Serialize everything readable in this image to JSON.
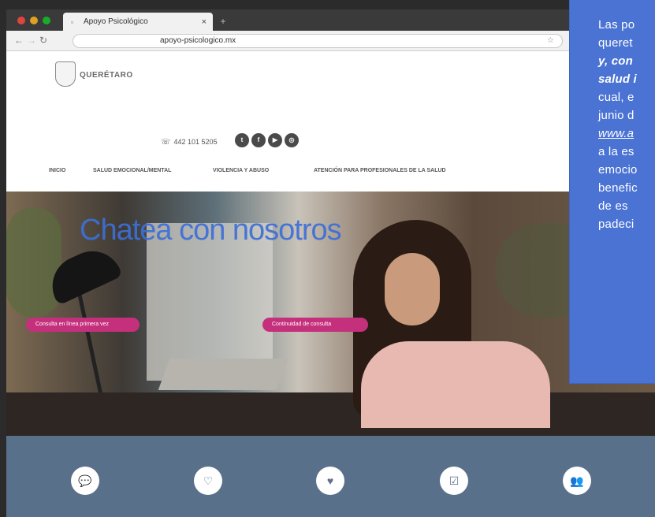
{
  "browser": {
    "tab_title": "Apoyo Psicológico",
    "tab_close": "×",
    "new_tab": "+",
    "url": "apoyo-psicologico.mx"
  },
  "site": {
    "logo_small_text": "",
    "logo_name": "QUERÉTARO",
    "phone": "442 101 5205",
    "nav": [
      {
        "label": "INICIO"
      },
      {
        "label": "SALUD EMOCIONAL/MENTAL"
      },
      {
        "label": "VIOLENCIA Y ABUSO"
      },
      {
        "label": "ATENCIÓN PARA PROFESIONALES DE LA SALUD"
      }
    ],
    "hero_title": "Chatea con nosotros",
    "button_primary": "Consulta en línea primera vez",
    "button_secondary": "Continuidad de consulta"
  },
  "overlay": {
    "lines": [
      "Las po",
      "queret",
      "y, con",
      "salud i",
      "cual, e",
      "junio d",
      "www.a",
      "a la es",
      "emocio",
      "benefic",
      "de es",
      "padeci"
    ]
  },
  "colors": {
    "overlay_bg": "#4a73d4",
    "band_bg": "#59708b",
    "pill": "#c4307c",
    "hero_title": "#3c6fd8"
  }
}
